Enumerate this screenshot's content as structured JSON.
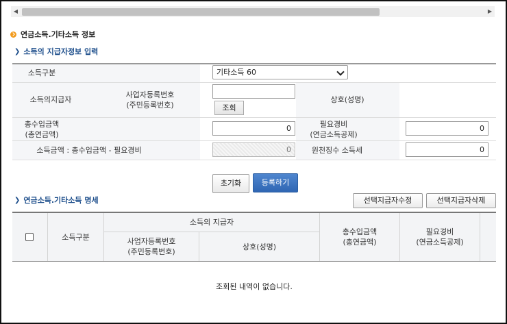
{
  "scrollbar": {
    "left_arrow": "◀",
    "right_arrow": "▶"
  },
  "section": {
    "title": "연금소득.기타소득 정보"
  },
  "input_section": {
    "title": "소득의 지급자정보 입력"
  },
  "form": {
    "income_type_label": "소득구분",
    "income_type_value": "기타소득 60",
    "payer_label": "소득의지급자",
    "bizno_label_1": "사업자등록번호",
    "bizno_label_2": "(주민등록번호)",
    "bizno_value": "",
    "lookup_button": "조회",
    "company_label": "상호(성명)",
    "company_value": "",
    "total_label_1": "총수입금액",
    "total_label_2": "(총연금액)",
    "total_value": "0",
    "expense_label_1": "필요경비",
    "expense_label_2": "(연금소득공제)",
    "expense_value": "0",
    "income_amount_label": "소득금액 : 총수입금액 - 필요경비",
    "income_amount_value": "0",
    "withholding_label": "원천징수 소득세",
    "withholding_value": "0"
  },
  "actions": {
    "reset": "초기화",
    "register": "등록하기"
  },
  "list_section": {
    "title": "연금소득.기타소득 명세",
    "edit_button": "선택지급자수정",
    "delete_button": "선택지급자삭제"
  },
  "table": {
    "col_type": "소득구분",
    "col_payer": "소득의 지급자",
    "col_bizno_1": "사업자등록번호",
    "col_bizno_2": "(주민등록번호)",
    "col_company": "상호(성명)",
    "col_total_1": "총수입금액",
    "col_total_2": "(총연금액)",
    "col_expense_1": "필요경비",
    "col_expense_2": "(연금소득공제)",
    "empty_message": "조회된 내역이 없습니다."
  }
}
